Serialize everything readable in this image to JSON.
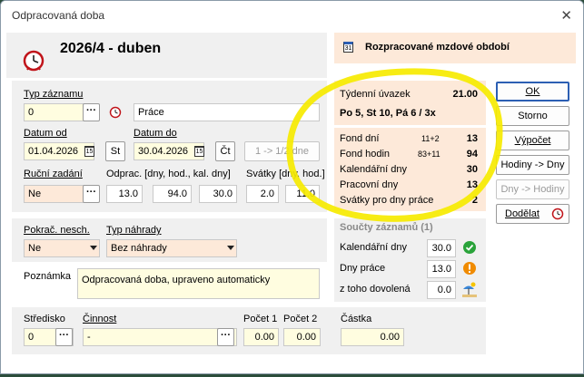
{
  "window": {
    "title": "Odpracovaná doba",
    "close": "✕"
  },
  "header": {
    "period": "2026/4 - duben",
    "state": "Rozpracované mzdové období",
    "cal_day": "31"
  },
  "record": {
    "type_label": "Typ záznamu",
    "type_value": "0",
    "type_name": "Práce",
    "date_from_label": "Datum od",
    "date_from": "01.04.2026",
    "date_from_day": "St",
    "date_to_label": "Datum do",
    "date_to": "30.04.2026",
    "date_to_day": "Čt",
    "ratio_button": "1 -> 1/2 dne",
    "manual_label": "Ruční zadání",
    "manual_value": "Ne",
    "worked_label": "Odprac. [dny, hod., kal. dny]",
    "worked_days": "13.0",
    "worked_hours": "94.0",
    "worked_cal": "30.0",
    "holiday_label": "Svátky [dny, hod.]",
    "holiday_days": "2.0",
    "holiday_hours": "11.0"
  },
  "sickness": {
    "cont_label": "Pokrač. nesch.",
    "cont_value": "Ne",
    "comp_label": "Typ náhrady",
    "comp_value": "Bez náhrady"
  },
  "note": {
    "label": "Poznámka",
    "value": "Odpracovaná doba, upraveno automaticky"
  },
  "bottom": {
    "center_label": "Středisko",
    "center_value": "0",
    "activity_label": "Činnost",
    "activity_value": "-",
    "count1_label": "Počet 1",
    "count1_value": "0.00",
    "count2_label": "Počet 2",
    "count2_value": "0.00",
    "amount_label": "Částka",
    "amount_value": "0.00"
  },
  "workload": {
    "label": "Týdenní úvazek",
    "value": "21.00",
    "pattern": "Po 5, St 10, Pá 6 / 3x"
  },
  "funds": {
    "rows": [
      {
        "label": "Fond dní",
        "extra": "11+2",
        "value": "13"
      },
      {
        "label": "Fond hodin",
        "extra": "83+11",
        "value": "94"
      },
      {
        "label": "Kalendářní dny",
        "extra": "",
        "value": "30"
      },
      {
        "label": "Pracovní dny",
        "extra": "",
        "value": "13"
      },
      {
        "label": "Svátky pro dny práce",
        "extra": "",
        "value": "2"
      }
    ]
  },
  "sums": {
    "title": "Součty záznamů  (1)",
    "cal_label": "Kalendářní dny",
    "cal_value": "30.0",
    "work_label": "Dny práce",
    "work_value": "13.0",
    "vac_label": "z toho dovolená",
    "vac_value": "0.0"
  },
  "buttons": {
    "ok": "OK",
    "cancel": "Storno",
    "calc": "Výpočet",
    "hours_days": "Hodiny -> Dny",
    "days_hours": "Dny -> Hodiny",
    "refine": "Dodělat"
  },
  "colors": {
    "accent": "#2c5fb3",
    "highlight": "#f6ea00",
    "peach": "#fde9d9",
    "input_yellow": "#fffde0"
  }
}
